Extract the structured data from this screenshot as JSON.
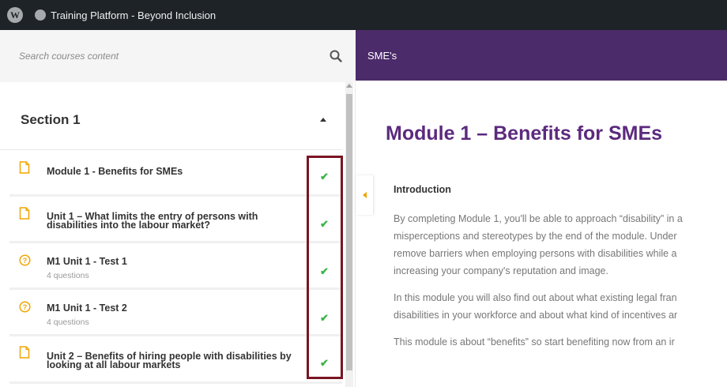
{
  "admin_bar": {
    "wp_logo": "W",
    "site_title": "Training Platform - Beyond Inclusion"
  },
  "search": {
    "placeholder": "Search courses content"
  },
  "section": {
    "title": "Section 1"
  },
  "curriculum_items": [
    {
      "type": "lesson",
      "title_line1": "Module 1 - Benefits for SMEs",
      "title_line2": "",
      "sub": "",
      "completed": true
    },
    {
      "type": "lesson",
      "title_line1": "Unit 1 – What limits the entry of persons with",
      "title_line2": "disabilities into the labour market?",
      "sub": "",
      "completed": true
    },
    {
      "type": "quiz",
      "title_line1": "M1 Unit 1 - Test 1",
      "title_line2": "",
      "sub": "4 questions",
      "completed": true
    },
    {
      "type": "quiz",
      "title_line1": "M1 Unit 1 - Test 2",
      "title_line2": "",
      "sub": "4 questions",
      "completed": true
    },
    {
      "type": "lesson",
      "title_line1": "Unit 2 – Benefits of hiring people with disabilities by",
      "title_line2": "looking at all labour markets",
      "sub": "",
      "completed": true
    }
  ],
  "course": {
    "name": "SME's"
  },
  "content": {
    "title": "Module 1 – Benefits for SMEs",
    "intro_heading": "Introduction",
    "para1_lines": [
      "By completing Module 1, you'll be able to approach “disability” in a",
      "misperceptions and stereotypes by the end of the module. Under",
      "remove barriers when employing persons with disabilities while a",
      "increasing your  company's reputation and image."
    ],
    "para2_lines": [
      "In this module you will also find out about what existing legal fran",
      "disabilities in your workforce and about what kind of incentives ar"
    ],
    "para3_lines": [
      "This module is about “benefits” so start benefiting now from an ir"
    ]
  },
  "colors": {
    "course_bar": "#4b2b69",
    "title_purple": "#5c2a7e",
    "check_green": "#3bb54a",
    "accent_orange": "#f0a500",
    "highlight_box": "#7b1523"
  }
}
